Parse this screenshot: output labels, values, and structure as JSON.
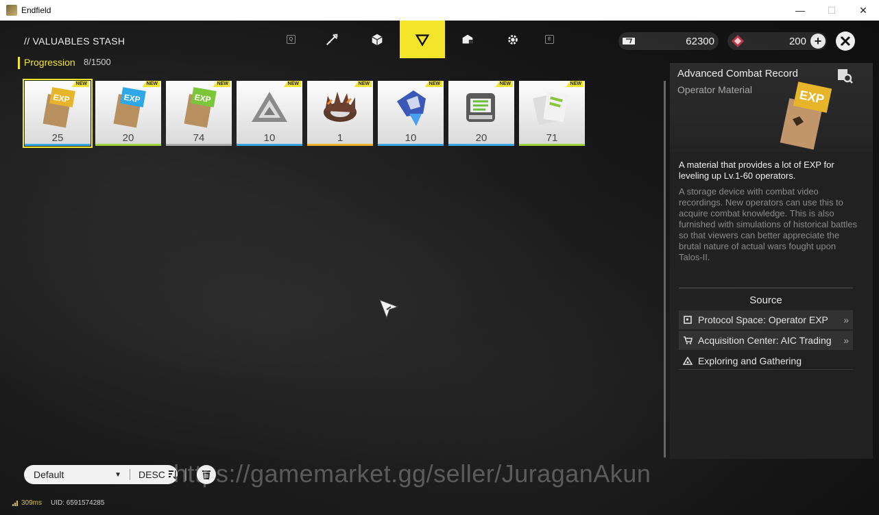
{
  "window": {
    "title": "Endfield",
    "min": "—",
    "max": "☐",
    "close": "✕"
  },
  "header": {
    "title": "// VALUABLES STASH"
  },
  "tabs": {
    "key_left": "Q",
    "key_right": "E",
    "items": [
      {
        "name": "tab-weapon",
        "icon": "weapon-icon"
      },
      {
        "name": "tab-cube",
        "icon": "cube-icon"
      },
      {
        "name": "tab-progression",
        "icon": "triangle-icon",
        "active": true
      },
      {
        "name": "tab-box",
        "icon": "box-icon"
      },
      {
        "name": "tab-gear",
        "icon": "gear-icon"
      }
    ]
  },
  "currency": [
    {
      "icon": "ticket-icon",
      "amount": "62300"
    },
    {
      "icon": "crystal-icon",
      "amount": "200"
    }
  ],
  "category": {
    "label": "Progression",
    "count": "8/1500"
  },
  "items": [
    {
      "qty": "25",
      "new": "NEW",
      "rarity_color": "#39a7e6",
      "art": "exp-gold"
    },
    {
      "qty": "20",
      "new": "NEW",
      "rarity_color": "#9fd33a",
      "art": "exp-blue"
    },
    {
      "qty": "74",
      "new": "NEW",
      "rarity_color": "#aaaaaa",
      "art": "exp-green"
    },
    {
      "qty": "10",
      "new": "NEW",
      "rarity_color": "#39a7e6",
      "art": "prism"
    },
    {
      "qty": "1",
      "new": "NEW",
      "rarity_color": "#f0b02a",
      "art": "crown"
    },
    {
      "qty": "10",
      "new": "NEW",
      "rarity_color": "#39a7e6",
      "art": "blue-crystal"
    },
    {
      "qty": "20",
      "new": "NEW",
      "rarity_color": "#39a7e6",
      "art": "device"
    },
    {
      "qty": "71",
      "new": "NEW",
      "rarity_color": "#9fd33a",
      "art": "cards"
    }
  ],
  "detail": {
    "name": "Advanced Combat Record",
    "type": "Operator Material",
    "desc_main": "A material that provides a lot of EXP for leveling up Lv.1-60 operators.",
    "desc_sub": "A storage device with combat video recordings. New operators can use this to acquire combat knowledge. This is also furnished with simulations of historical battles so that viewers can better appreciate the brutal nature of actual wars fought upon Talos-II.",
    "source_title": "Source",
    "sources": [
      {
        "label": "Protocol Space: Operator EXP",
        "icon": "protocol-icon",
        "arrow": "»"
      },
      {
        "label": "Acquisition Center: AIC Trading",
        "icon": "cart-icon",
        "arrow": "»"
      },
      {
        "label": "Exploring and Gathering",
        "icon": "explore-icon",
        "arrow": ""
      }
    ]
  },
  "sort": {
    "default": "Default",
    "order": "DESC"
  },
  "watermark": "https://gamemarket.gg/seller/JuraganAkun",
  "status": {
    "ping": "309ms",
    "uid": "UID: 6591574285"
  }
}
